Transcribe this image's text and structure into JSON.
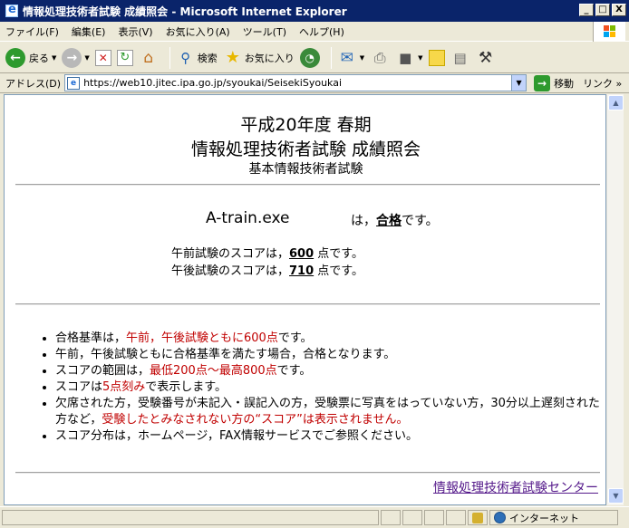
{
  "window": {
    "title": "情報処理技術者試験 成績照会 - Microsoft Internet Explorer",
    "minimize": "_",
    "maximize": "□",
    "close": "X"
  },
  "menu": {
    "file": "ファイル(F)",
    "edit": "編集(E)",
    "view": "表示(V)",
    "favorites": "お気に入り(A)",
    "tools": "ツール(T)",
    "help": "ヘルプ(H)"
  },
  "toolbar": {
    "back": "戻る",
    "search": "検索",
    "favorites": "お気に入り"
  },
  "address": {
    "label": "アドレス(D)",
    "url": "https://web10.jitec.ipa.go.jp/syoukai/SeisekiSyoukai",
    "go": "移動",
    "links": "リンク"
  },
  "page": {
    "heading1": "平成20年度 春期",
    "heading2": "情報処理技術者試験 成績照会",
    "heading3": "基本情報技術者試験",
    "examinee": "A-train.exe",
    "result_prefix": "は，",
    "result_value": "合格",
    "result_suffix": "です。",
    "am_prefix": "午前試験のスコアは，",
    "am_score": "600",
    "am_suffix": " 点です。",
    "pm_prefix": "午後試験のスコアは，",
    "pm_score": "710",
    "pm_suffix": " 点です。",
    "rule1_a": "合格基準は，",
    "rule1_b": "午前，午後試験ともに600点",
    "rule1_c": "です。",
    "rule2": "午前，午後試験ともに合格基準を満たす場合，合格となります。",
    "rule3_a": "スコアの範囲は，",
    "rule3_b": "最低200点～最高800点",
    "rule3_c": "です。",
    "rule4_a": "スコアは",
    "rule4_b": "5点刻み",
    "rule4_c": "で表示します。",
    "rule5_a": "欠席された方，受験番号が未記入・誤記入の方，受験票に写真をはっていない方，30分以上遅刻された方など，",
    "rule5_b": "受験したとみなされない方の“スコア”は表示されません。",
    "rule6": "スコア分布は，ホームページ，FAX情報サービスでご参照ください。",
    "footer_link": "情報処理技術者試験センター"
  },
  "status": {
    "zone": "インターネット"
  }
}
